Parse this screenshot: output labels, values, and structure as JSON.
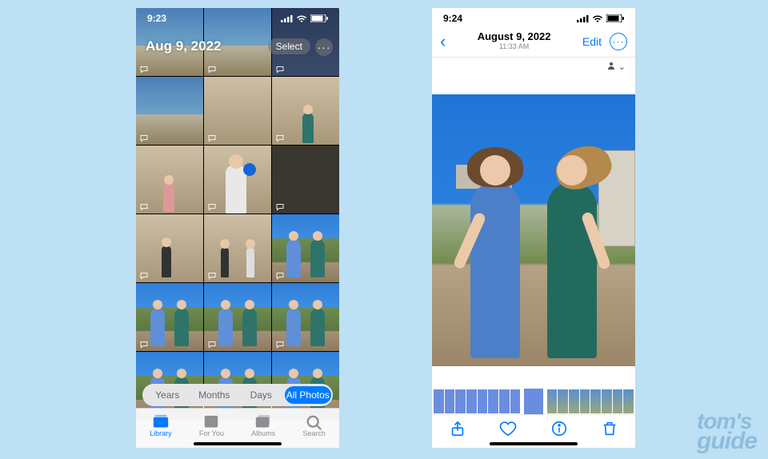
{
  "left": {
    "time": "9:23",
    "date_header": "Aug 9, 2022",
    "select_label": "Select",
    "more_label": "···",
    "segments": [
      {
        "label": "Years",
        "active": false
      },
      {
        "label": "Months",
        "active": false
      },
      {
        "label": "Days",
        "active": false
      },
      {
        "label": "All Photos",
        "active": true
      }
    ],
    "tabs": [
      {
        "label": "Library",
        "active": true
      },
      {
        "label": "For You",
        "active": false
      },
      {
        "label": "Albums",
        "active": false
      },
      {
        "label": "Search",
        "active": false
      }
    ]
  },
  "right": {
    "time": "9:24",
    "nav_date": "August 9, 2022",
    "nav_time": "11:33 AM",
    "edit_label": "Edit",
    "more_label": "···",
    "people_chevron": "⌄",
    "toolbar": [
      {
        "name": "share"
      },
      {
        "name": "favorite"
      },
      {
        "name": "info"
      },
      {
        "name": "trash"
      }
    ]
  },
  "watermark": {
    "line1": "tom's",
    "line2": "guide"
  }
}
